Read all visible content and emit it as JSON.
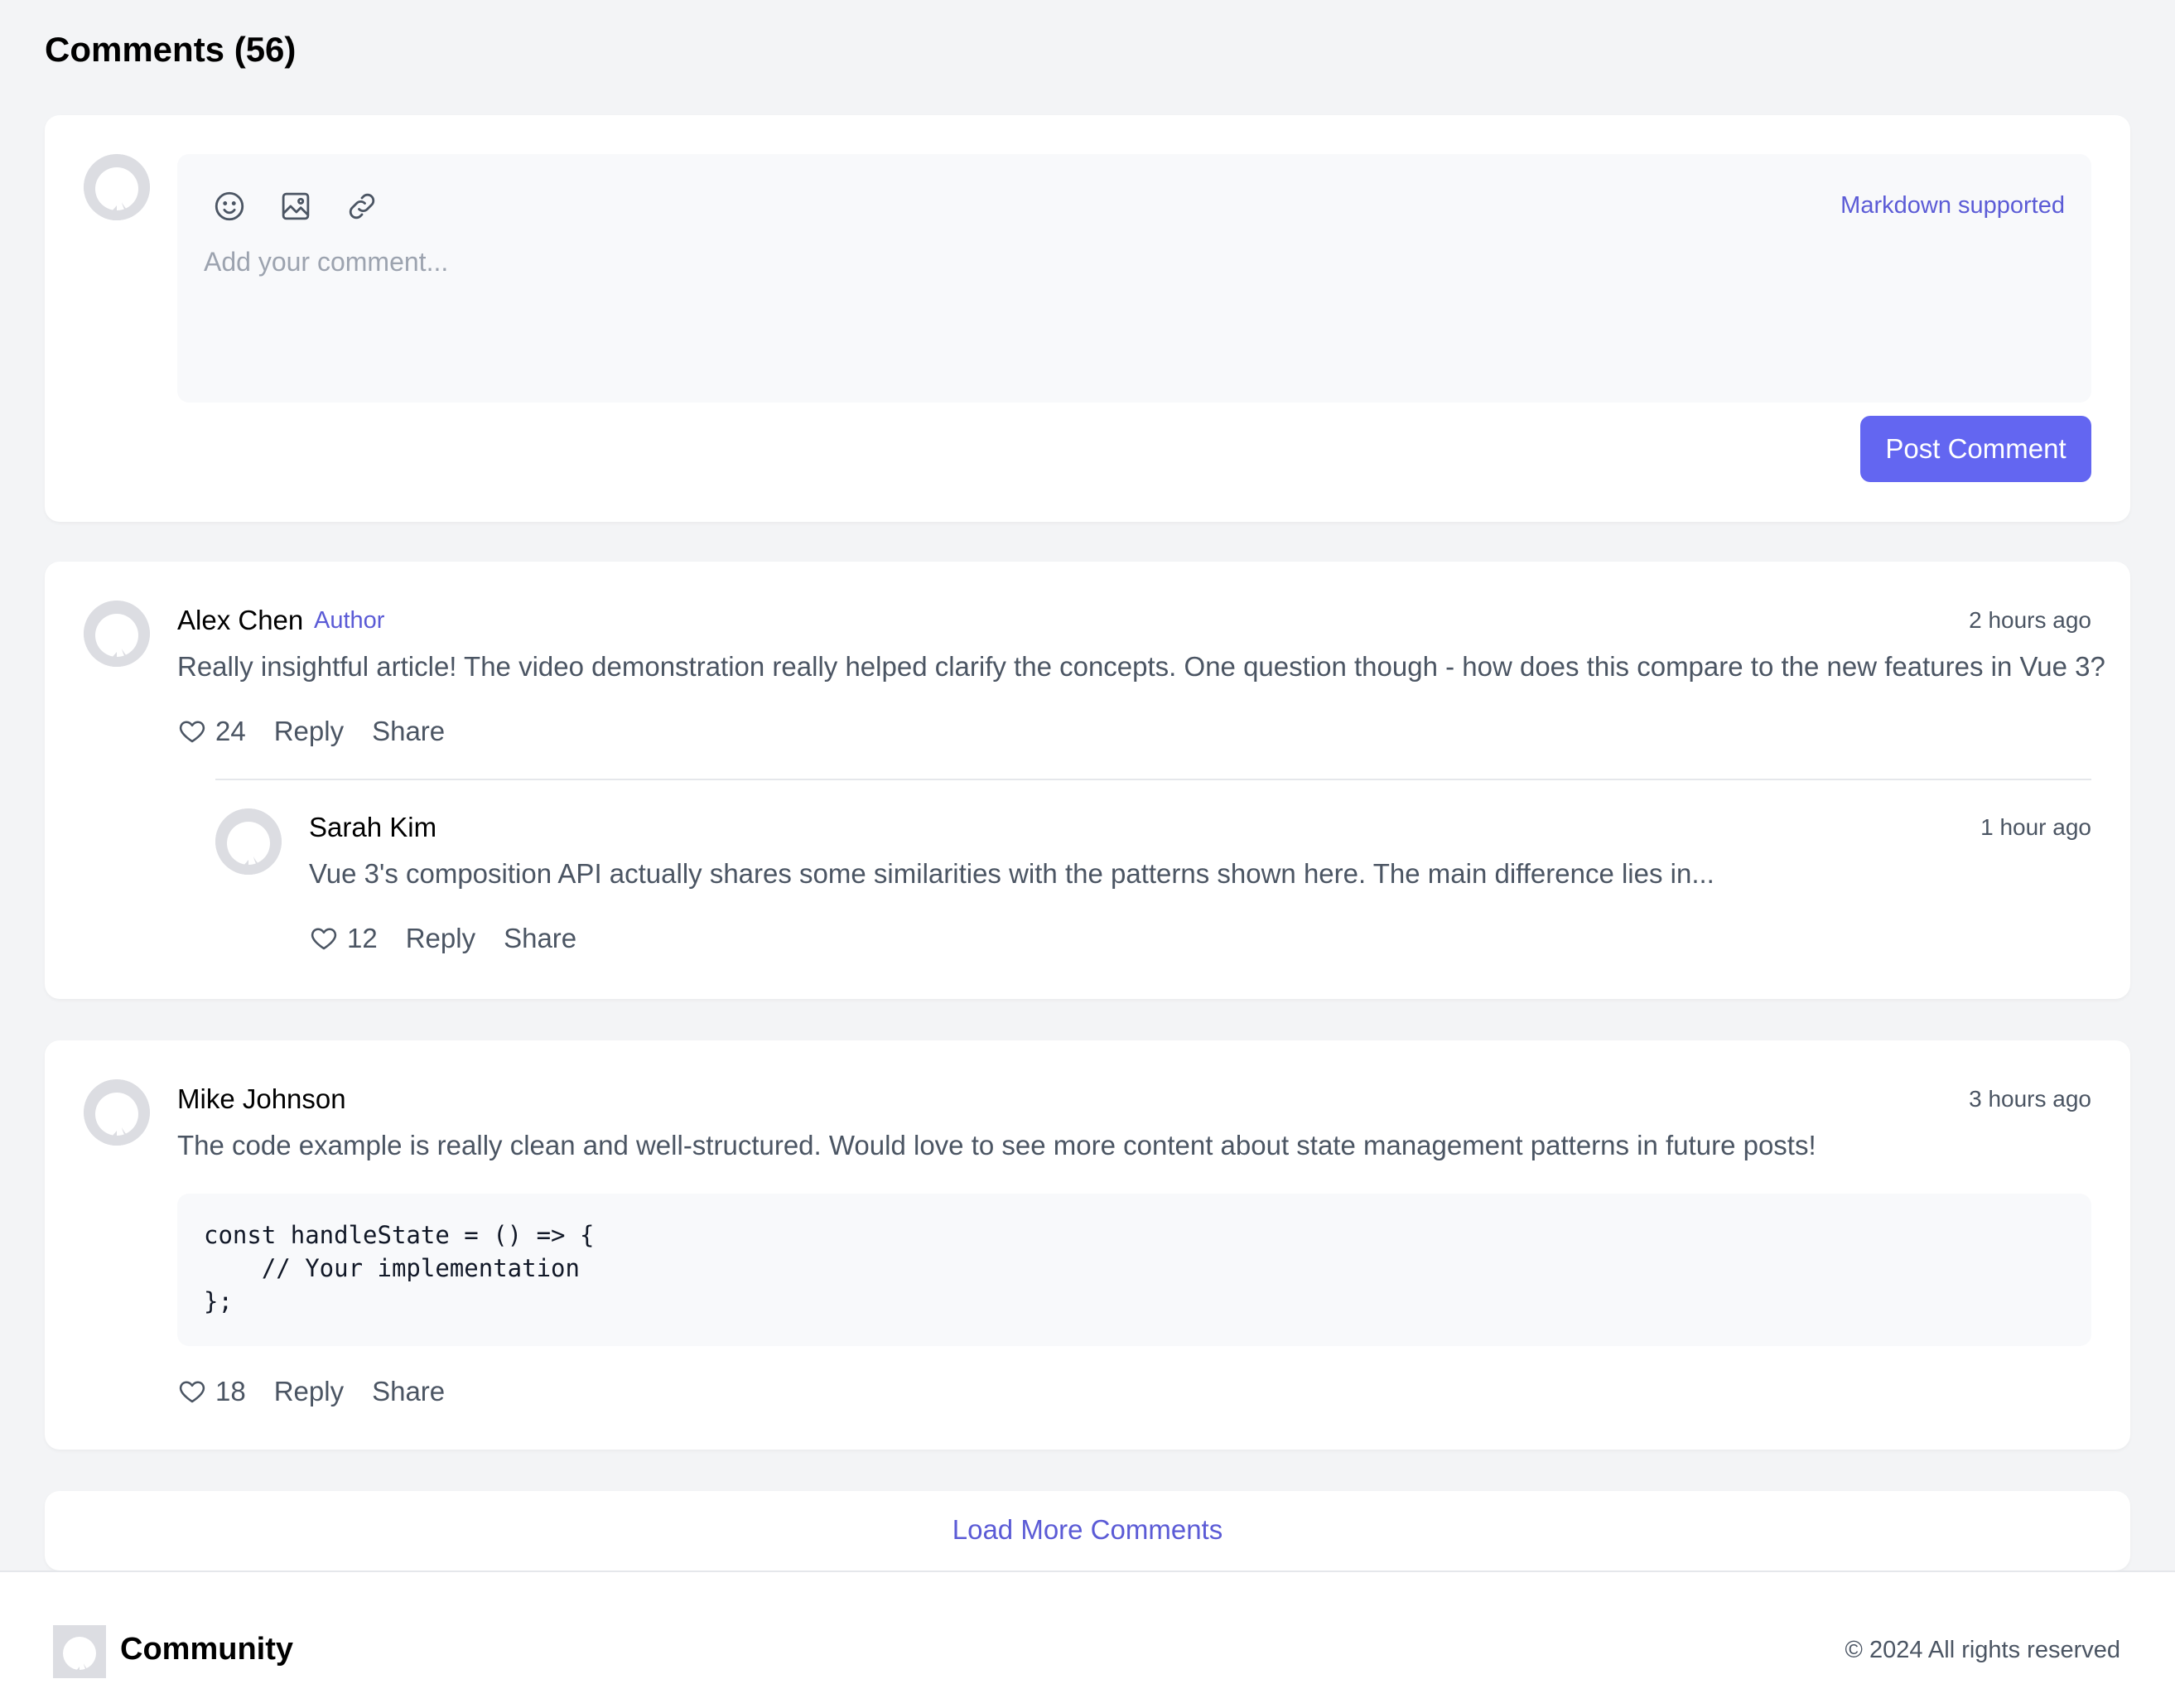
{
  "header": {
    "title": "Comments (56)"
  },
  "composer": {
    "markdown_hint": "Markdown supported",
    "placeholder": "Add your comment...",
    "value": "",
    "post_label": "Post Comment",
    "tools": [
      "emoji-icon",
      "image-icon",
      "link-icon"
    ]
  },
  "comments": [
    {
      "author": "Alex Chen",
      "badge": "Author",
      "time": "2 hours ago",
      "text": "Really insightful article! The video demonstration really helped clarify the concepts. One question though - how does this compare to the new features in Vue 3?",
      "likes": "24",
      "reply_label": "Reply",
      "share_label": "Share",
      "replies": [
        {
          "author": "Sarah Kim",
          "time": "1 hour ago",
          "text": "Vue 3's composition API actually shares some similarities with the patterns shown here. The main difference lies in...",
          "likes": "12",
          "reply_label": "Reply",
          "share_label": "Share"
        }
      ]
    },
    {
      "author": "Mike Johnson",
      "time": "3 hours ago",
      "text": "The code example is really clean and well-structured. Would love to see more content about state management patterns in future posts!",
      "code": "const handleState = () => {\n    // Your implementation\n};",
      "likes": "18",
      "reply_label": "Reply",
      "share_label": "Share"
    }
  ],
  "load_more_label": "Load More Comments",
  "footer": {
    "brand": "Community",
    "copyright": "© 2024 All rights reserved"
  },
  "colors": {
    "accent": "#6366f1",
    "accent_text": "#5b5bd6",
    "background": "#f3f4f6",
    "muted_text": "#4b5563"
  }
}
